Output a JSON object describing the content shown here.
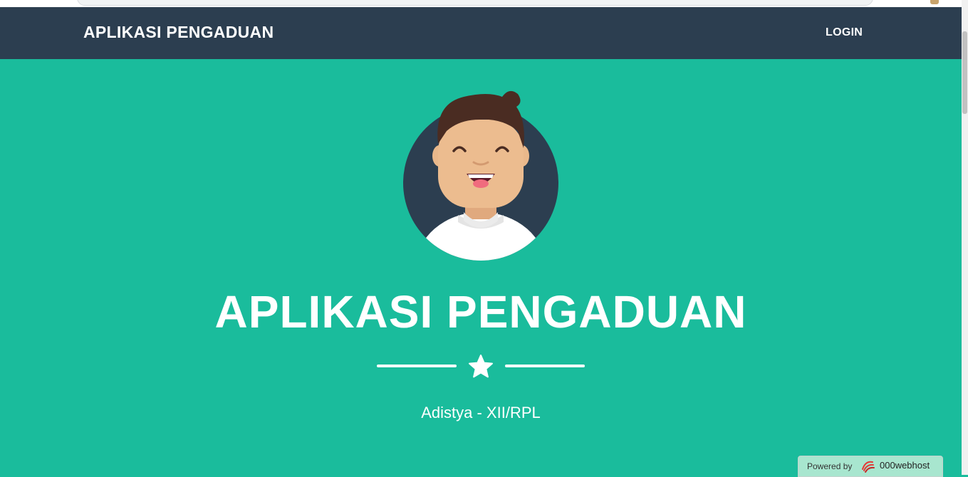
{
  "navbar": {
    "brand": "APLIKASI PENGADUAN",
    "login_label": "LOGIN"
  },
  "hero": {
    "avatar_icon": "smiling-avatar-icon",
    "title": "APLIKASI PENGADUAN",
    "divider_icon": "star-icon",
    "subtitle": "Adistya - XII/RPL"
  },
  "footer_badge": {
    "powered_label": "Powered by",
    "host_name": "000webhost",
    "logo_icon": "000webhost-logo-icon"
  },
  "colors": {
    "navbar_bg": "#2c3e50",
    "hero_bg": "#1abc9c",
    "text": "#ffffff",
    "avatar_circle": "#2c3e50"
  }
}
